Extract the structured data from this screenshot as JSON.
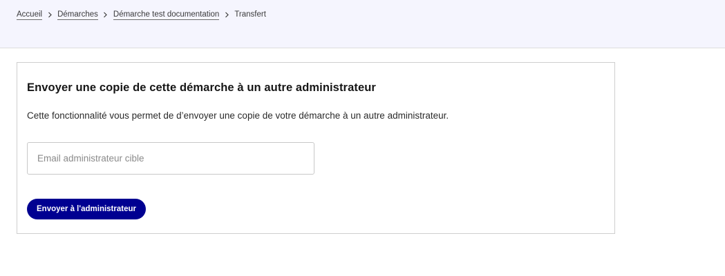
{
  "breadcrumb": {
    "items": [
      {
        "label": "Accueil"
      },
      {
        "label": "Démarches"
      },
      {
        "label": "Démarche test documentation"
      }
    ],
    "current": "Transfert"
  },
  "card": {
    "title": "Envoyer une copie de cette démarche à un autre administrateur",
    "description": "Cette fonctionnalité vous permet de d’envoyer une copie de votre démarche à un autre administrateur.",
    "email_input": {
      "value": "",
      "placeholder": "Email administrateur cible"
    },
    "submit_label": "Envoyer à l'administrateur"
  },
  "colors": {
    "header_background": "#f5f5fe",
    "primary_button": "#000091",
    "card_border": "#cecece"
  },
  "icons": {
    "separator": "chevron-right-icon"
  }
}
